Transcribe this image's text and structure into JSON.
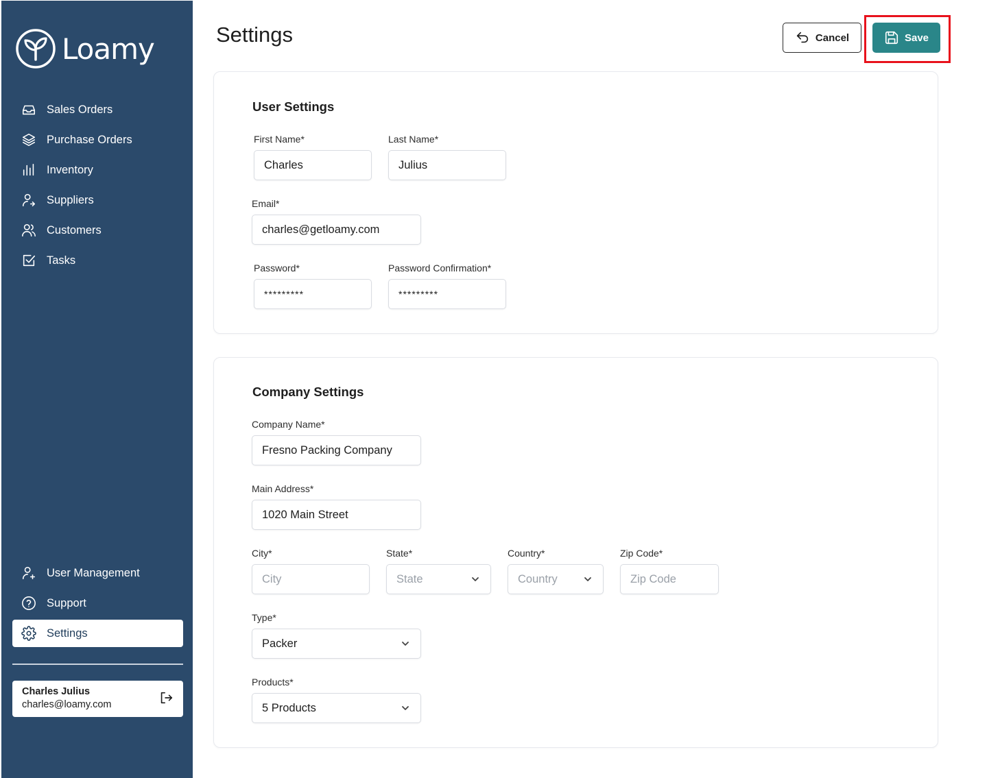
{
  "brand": {
    "name": "Loamy"
  },
  "sidebar": {
    "top_items": [
      {
        "label": "Sales Orders",
        "icon": "inbox-icon"
      },
      {
        "label": "Purchase Orders",
        "icon": "layers-icon"
      },
      {
        "label": "Inventory",
        "icon": "bar-chart-icon"
      },
      {
        "label": "Suppliers",
        "icon": "user-arrow-icon"
      },
      {
        "label": "Customers",
        "icon": "users-icon"
      },
      {
        "label": "Tasks",
        "icon": "checkbox-icon"
      }
    ],
    "bottom_items": [
      {
        "label": "User Management",
        "icon": "user-plus-icon"
      },
      {
        "label": "Support",
        "icon": "help-circle-icon"
      },
      {
        "label": "Settings",
        "icon": "gear-icon",
        "active": true
      }
    ],
    "user": {
      "name": "Charles Julius",
      "email": "charles@loamy.com"
    }
  },
  "header": {
    "title": "Settings",
    "cancel_label": "Cancel",
    "save_label": "Save"
  },
  "user_settings": {
    "title": "User Settings",
    "first_name": {
      "label": "First Name*",
      "value": "Charles"
    },
    "last_name": {
      "label": "Last Name*",
      "value": "Julius"
    },
    "email": {
      "label": "Email*",
      "value": "charles@getloamy.com"
    },
    "password": {
      "label": "Password*",
      "value": "*********"
    },
    "password_confirmation": {
      "label": "Password Confirmation*",
      "value": "*********"
    }
  },
  "company_settings": {
    "title": "Company Settings",
    "company_name": {
      "label": "Company Name*",
      "value": "Fresno Packing Company"
    },
    "main_address": {
      "label": "Main Address*",
      "value": "1020 Main Street"
    },
    "city": {
      "label": "City*",
      "placeholder": "City"
    },
    "state": {
      "label": "State*",
      "placeholder": "State"
    },
    "country": {
      "label": "Country*",
      "placeholder": "Country"
    },
    "zip_code": {
      "label": "Zip Code*",
      "placeholder": "Zip Code"
    },
    "type": {
      "label": "Type*",
      "value": "Packer"
    },
    "products": {
      "label": "Products*",
      "value": "5 Products"
    }
  },
  "colors": {
    "sidebar_bg": "#2b4a6b",
    "accent": "#2a8689",
    "highlight": "#e8121c"
  }
}
